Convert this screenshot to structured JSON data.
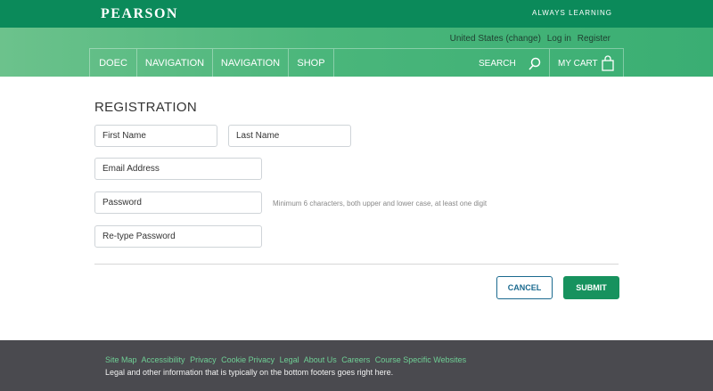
{
  "brand": {
    "logo": "PEARSON",
    "tagline": "ALWAYS LEARNING"
  },
  "utility": {
    "region": "United States",
    "change": "change",
    "login": "Log in",
    "register": "Register"
  },
  "nav": {
    "items": [
      "DOEC",
      "NAVIGATION",
      "NAVIGATION",
      "SHOP"
    ],
    "search_label": "SEARCH",
    "cart_label": "MY CART",
    "search_icon": "search-icon",
    "cart_icon": "shopping-bag-icon"
  },
  "form": {
    "title": "REGISTRATION",
    "fields": {
      "first_name": "First Name",
      "last_name": "Last Name",
      "email": "Email Address",
      "password": "Password",
      "retype_password": "Re-type Password"
    },
    "password_hint": "Minimum 6 characters, both upper and lower case, at least one digit",
    "cancel_label": "CANCEL",
    "submit_label": "SUBMIT"
  },
  "footer": {
    "links": [
      "Site Map",
      "Accessibility",
      "Privacy",
      "Cookie Privacy",
      "Legal",
      "About Us",
      "Careers",
      "Course Specific Websites"
    ],
    "legal_text": "Legal and other information that is typically on the bottom footers goes right here."
  },
  "colors": {
    "brand_green": "#0b8a5a",
    "submit_green": "#17925e",
    "cancel_blue": "#1b6a8f",
    "footer_bg": "#4a4a4f",
    "footer_link": "#6fcf95"
  }
}
